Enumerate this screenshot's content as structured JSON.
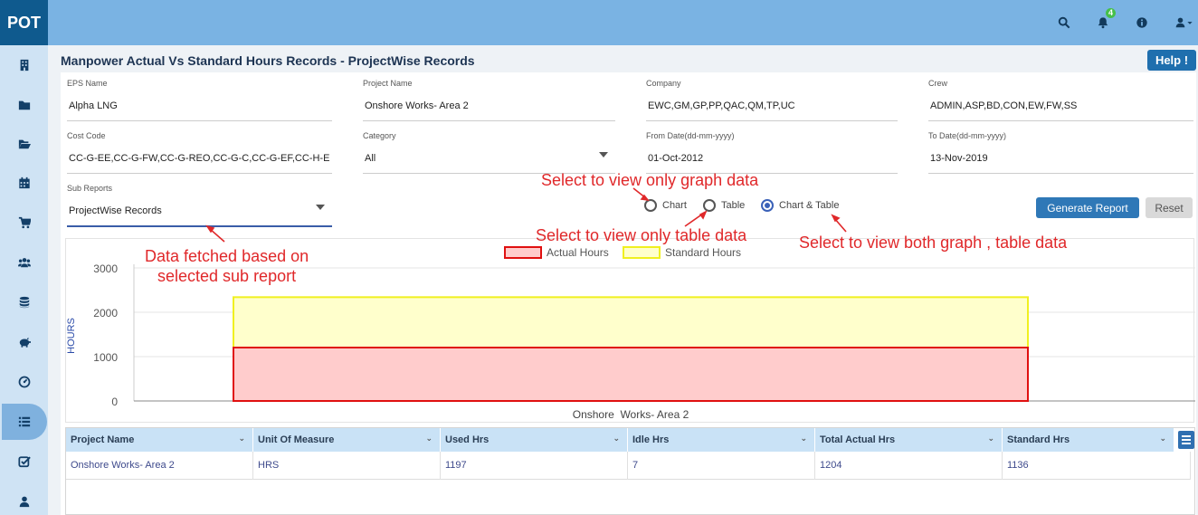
{
  "app": {
    "logo": "POT",
    "notification_count": "4"
  },
  "top_icons": [
    "search-icon",
    "bell-icon",
    "info-icon",
    "user-icon"
  ],
  "sidebar": {
    "items": [
      {
        "name": "building-icon"
      },
      {
        "name": "folder-icon"
      },
      {
        "name": "folder-open-icon"
      },
      {
        "name": "calendar-icon"
      },
      {
        "name": "cart-icon"
      },
      {
        "name": "users-icon"
      },
      {
        "name": "database-icon"
      },
      {
        "name": "piggy-bank-icon"
      },
      {
        "name": "dashboard-icon"
      },
      {
        "name": "list-icon"
      },
      {
        "name": "checkbox-icon"
      },
      {
        "name": "user-icon"
      }
    ],
    "active_index": 9
  },
  "page": {
    "title": "Manpower Actual Vs Standard Hours Records - ProjectWise Records",
    "help_label": "Help !"
  },
  "form": {
    "eps_name": {
      "label": "EPS Name",
      "value": "Alpha LNG"
    },
    "project_name": {
      "label": "Project Name",
      "value": "Onshore  Works- Area 2"
    },
    "company": {
      "label": "Company",
      "value": "EWC,GM,GP,PP,QAC,QM,TP,UC"
    },
    "crew": {
      "label": "Crew",
      "value": "ADMIN,ASP,BD,CON,EW,FW,SS"
    },
    "cost_code": {
      "label": "Cost Code",
      "value": "CC-G-EE,CC-G-FW,CC-G-REO,CC-G-C,CC-G-EF,CC-H-E"
    },
    "category": {
      "label": "Category",
      "value": "All"
    },
    "from_date": {
      "label": "From Date(dd-mm-yyyy)",
      "value": "01-Oct-2012"
    },
    "to_date": {
      "label": "To Date(dd-mm-yyyy)",
      "value": "13-Nov-2019"
    },
    "sub_reports": {
      "label": "Sub Reports",
      "value": "ProjectWise Records"
    }
  },
  "view_options": [
    {
      "label": "Chart",
      "checked": false
    },
    {
      "label": "Table",
      "checked": false
    },
    {
      "label": "Chart & Table",
      "checked": true
    }
  ],
  "buttons": {
    "generate": "Generate Report",
    "reset": "Reset"
  },
  "annotations": {
    "graph_only": "Select to view only graph data",
    "table_only": "Select to view only table data",
    "both": "Select to view both graph , table data",
    "sub_report_line1": "Data fetched based on",
    "sub_report_line2": "selected sub report"
  },
  "chart_data": {
    "type": "bar",
    "categories": [
      "Onshore  Works- Area 2"
    ],
    "series": [
      {
        "name": "Actual Hours",
        "values": [
          1204
        ],
        "color": "#ffcccc",
        "stroke": "#e01010"
      },
      {
        "name": "Standard Hours",
        "values": [
          2340
        ],
        "color": "#ffffcc",
        "stroke": "#f0f020"
      }
    ],
    "stacking": "overlap",
    "ylabel": "HOURS",
    "xlabel": "",
    "ylim": [
      0,
      3000
    ],
    "yticks": [
      0,
      1000,
      2000,
      3000
    ],
    "legend": "top-center",
    "grid": true
  },
  "table": {
    "columns": [
      "Project Name",
      "Unit Of Measure",
      "Used Hrs",
      "Idle Hrs",
      "Total Actual Hrs",
      "Standard Hrs"
    ],
    "rows": [
      [
        "Onshore Works- Area 2",
        "HRS",
        "1197",
        "7",
        "1204",
        "1136"
      ]
    ]
  }
}
